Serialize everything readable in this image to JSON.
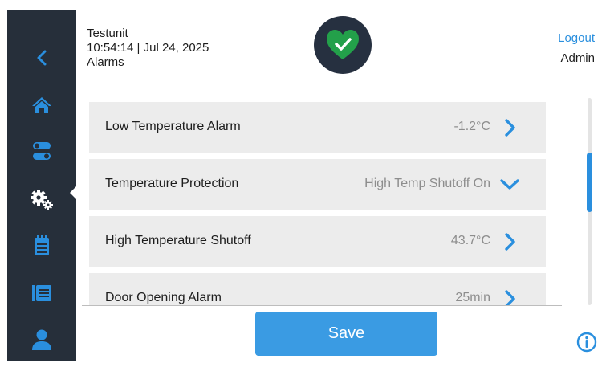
{
  "header": {
    "unit_name": "Testunit",
    "datetime": "10:54:14 | Jul 24, 2025",
    "page_title": "Alarms",
    "status_icon": "heart-check-icon",
    "logout_label": "Logout",
    "user_label": "Admin"
  },
  "sidebar": {
    "items": [
      {
        "name": "back",
        "icon": "chevron-left-icon",
        "active": false
      },
      {
        "name": "home",
        "icon": "home-icon",
        "active": false
      },
      {
        "name": "controls",
        "icon": "toggle-icon",
        "active": false
      },
      {
        "name": "settings",
        "icon": "gears-icon",
        "active": true
      },
      {
        "name": "log",
        "icon": "notepad-icon",
        "active": false
      },
      {
        "name": "history",
        "icon": "list-icon",
        "active": false
      },
      {
        "name": "user",
        "icon": "user-icon",
        "active": false
      }
    ]
  },
  "alarms": {
    "rows": [
      {
        "label": "Low Temperature Alarm",
        "value": "-1.2°C",
        "state": "collapsed"
      },
      {
        "label": "Temperature Protection",
        "value": "High Temp Shutoff On",
        "state": "expanded"
      },
      {
        "label": "High Temperature Shutoff",
        "value": "43.7°C",
        "state": "collapsed"
      },
      {
        "label": "Door Opening Alarm",
        "value": "25min",
        "state": "collapsed"
      }
    ]
  },
  "footer": {
    "save_label": "Save",
    "info_icon": "info-icon"
  },
  "colors": {
    "sidebar": "#262f3a",
    "accent": "#2a8fde",
    "status_ok": "#23a04a",
    "row_bg": "#ececec"
  }
}
